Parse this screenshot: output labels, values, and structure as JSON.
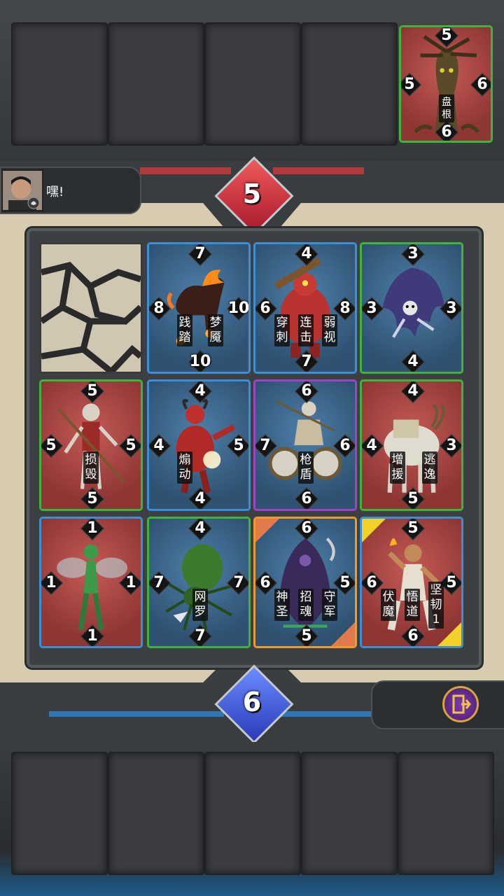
{
  "opponent": {
    "chat_message": "嘿!",
    "score": "5",
    "card_last": {
      "name": "盘根",
      "top": "5",
      "right": "6",
      "bottom": "6",
      "left": "5"
    }
  },
  "player": {
    "score": "6"
  },
  "board": {
    "cells": [
      {
        "id": "r0c0",
        "type": "rock"
      },
      {
        "id": "r0c1",
        "top": "7",
        "right": "10",
        "bottom": "10",
        "left": "8",
        "skills": [
          "践踏",
          "梦魇"
        ]
      },
      {
        "id": "r0c2",
        "top": "4",
        "right": "8",
        "bottom": "7",
        "left": "6",
        "skills": [
          "穿刺",
          "连击",
          "弱视"
        ]
      },
      {
        "id": "r0c3",
        "top": "3",
        "right": "3",
        "bottom": "4",
        "left": "3",
        "skills": []
      },
      {
        "id": "r1c0",
        "top": "5",
        "right": "5",
        "bottom": "5",
        "left": "5",
        "skills": [
          "损毁"
        ]
      },
      {
        "id": "r1c1",
        "top": "4",
        "right": "5",
        "bottom": "4",
        "left": "4",
        "skills": [
          "煽动"
        ]
      },
      {
        "id": "r1c2",
        "top": "6",
        "right": "6",
        "bottom": "6",
        "left": "7",
        "skills": [
          "枪盾"
        ]
      },
      {
        "id": "r1c3",
        "top": "4",
        "right": "3",
        "bottom": "5",
        "left": "4",
        "skills": [
          "增援",
          "逃逸"
        ]
      },
      {
        "id": "r2c0",
        "top": "1",
        "right": "1",
        "bottom": "1",
        "left": "1",
        "skills": []
      },
      {
        "id": "r2c1",
        "top": "4",
        "right": "7",
        "bottom": "7",
        "left": "7",
        "skills": [
          "网罗"
        ]
      },
      {
        "id": "r2c2",
        "top": "6",
        "right": "5",
        "bottom": "5",
        "left": "6",
        "skills": [
          "神圣",
          "招魂",
          "守军"
        ]
      },
      {
        "id": "r2c3",
        "top": "5",
        "right": "5",
        "bottom": "6",
        "left": "6",
        "skills": [
          "伏魔",
          "悟道",
          "坚韧1"
        ]
      }
    ]
  },
  "colors": {
    "opponent": "#3fb43c",
    "player": "#3b8fd6",
    "special": "#9b46c6",
    "highlight": "#ef9a2a"
  },
  "icons": {
    "exit": "exit-door-icon",
    "emote": "lotus-icon"
  }
}
